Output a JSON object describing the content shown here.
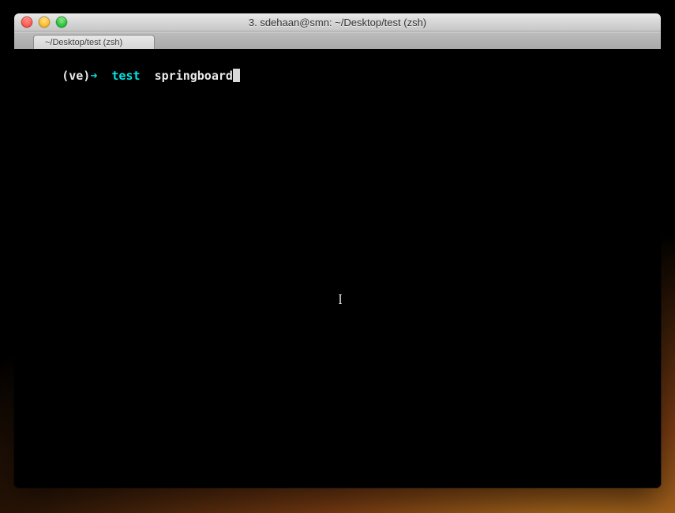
{
  "window": {
    "title": "3. sdehaan@smn: ~/Desktop/test (zsh)"
  },
  "tab": {
    "label": "~/Desktop/test (zsh)"
  },
  "prompt": {
    "env": "(ve)",
    "arrow": "➜",
    "dir": "test",
    "command": "springboard"
  },
  "colors": {
    "prompt_cyan": "#00e2e2",
    "terminal_bg": "#000000",
    "terminal_fg": "#eaeaea"
  }
}
